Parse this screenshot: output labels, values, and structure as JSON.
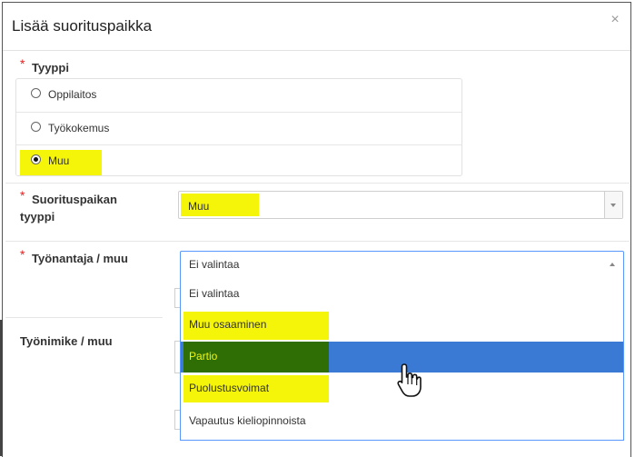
{
  "modal": {
    "title": "Lisää suorituspaikka",
    "close_label": "×"
  },
  "tyyppi": {
    "required_mark": "*",
    "label": "Tyyppi",
    "options": [
      {
        "label": "Oppilaitos",
        "checked": false
      },
      {
        "label": "Työkokemus",
        "checked": false
      },
      {
        "label": "Muu",
        "checked": true
      }
    ]
  },
  "suorituspaikan_tyyppi": {
    "required_mark": "*",
    "label_line1": "Suorituspaikan",
    "label_line2": "tyyppi",
    "value": "Muu"
  },
  "tyonantaja": {
    "required_mark": "*",
    "label": "Työnantaja / muu",
    "value": "Ei valintaa",
    "options": [
      {
        "label": "Ei valintaa",
        "highlighted": false
      },
      {
        "label": "Muu osaaminen",
        "highlighted": false
      },
      {
        "label": "Partio",
        "highlighted": true
      },
      {
        "label": "Puolustusvoimat",
        "highlighted": false
      },
      {
        "label": "Vapautus kieliopinnoista",
        "highlighted": false
      }
    ]
  },
  "tyonimike": {
    "label": "Työnimike / muu"
  },
  "colors": {
    "highlight_yellow": "#f5f50a",
    "highlight_green": "#2e6e04",
    "selected_option": "#3a79d4",
    "focus_border": "#5897fb",
    "required": "#e02020"
  }
}
